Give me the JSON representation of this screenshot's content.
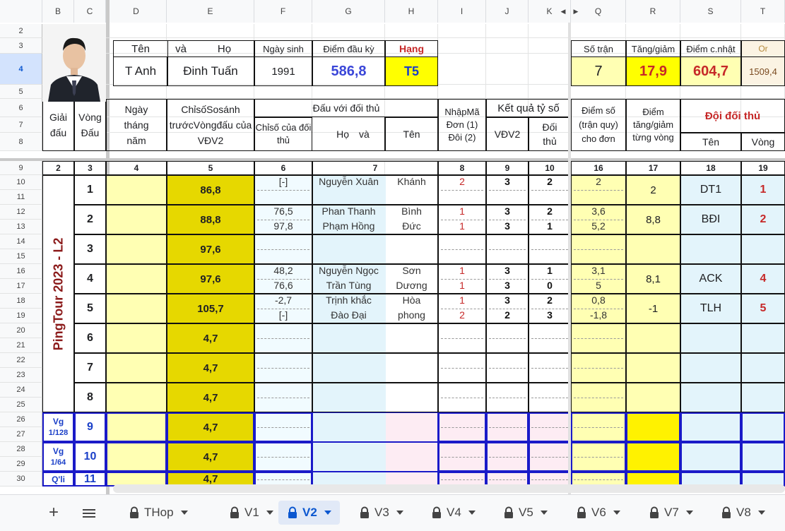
{
  "columns": [
    "B",
    "C",
    "D",
    "E",
    "F",
    "G",
    "H",
    "I",
    "J",
    "K",
    "Q",
    "R",
    "S",
    "T"
  ],
  "rows": [
    "2",
    "3",
    "4",
    "5",
    "6",
    "7",
    "8",
    "9",
    "10",
    "11",
    "12",
    "13",
    "14",
    "15",
    "16",
    "17",
    "18",
    "19",
    "20",
    "21",
    "22",
    "23",
    "24",
    "25",
    "26",
    "27",
    "28",
    "29",
    "30"
  ],
  "player": {
    "header": {
      "ten": "Tên",
      "va": "và",
      "ho": "Họ",
      "ngay_sinh": "Ngày sinh",
      "diem_dau_ky": "Điểm đầu kỳ",
      "hang": "Hạng"
    },
    "ten_value": "T Anh",
    "ho_value": "Đinh Tuấn",
    "ngay_sinh_value": "1991",
    "diem_dau_ky_value": "586,8",
    "hang_value": "T5"
  },
  "summary": {
    "header": {
      "so_tran": "Số trận",
      "tang_giam": "Tăng/giảm",
      "diem_cnhat": "Điểm c.nhật",
      "or": "Or"
    },
    "so_tran_value": "7",
    "tang_giam_value": "17,9",
    "diem_cnhat_value": "604,7",
    "or_value": "1509,4"
  },
  "table_header": {
    "giai_dau": "Giải đấu",
    "vong_dau": "Vòng Đấu",
    "ngay_thang_nam": "Ngày tháng năm",
    "chiso": "ChỉsốSosánh trướcVòngđấu của VĐV2",
    "dau_voi": "Đấu với đối thủ",
    "chiso_doithu": "Chỉsố của đối thủ",
    "ho": "Họ",
    "va": "và",
    "ten": "Tên",
    "nhap_ma": "NhậpMã Đơn (1) Đôi (2)",
    "ket_qua": "Kết quả tỷ số",
    "vdv2": "VĐV2",
    "doi_thu": "Đối thủ",
    "diem_so": "Điểm số (trận quy) cho đơn",
    "diem_tang_giam": "Điểm tăng/giảm từng vòng",
    "doi_doi_thu": "Đội đối thủ",
    "ten_doi": "Tên",
    "vong": "Vòng"
  },
  "colnums": [
    "2",
    "3",
    "4",
    "5",
    "6",
    "7",
    "8",
    "9",
    "10",
    "16",
    "17",
    "18",
    "19"
  ],
  "tournament": "PingTour 2023 - L2",
  "special_labels": [
    {
      "line1": "Vg",
      "line2": "1/128"
    },
    {
      "line1": "Vg",
      "line2": "1/64"
    },
    {
      "line1": "Q'li",
      "line2": ""
    }
  ],
  "rounds": [
    {
      "vong": "1",
      "chiso": "86,8",
      "matches": [
        {
          "chiso_dt": "[-]",
          "ho": "Nguyễn Xuân",
          "ten": "Khánh",
          "ma": "2",
          "vdv2": "3",
          "dt": "2",
          "diem": "2"
        }
      ],
      "tang": "2",
      "doi": "DT1",
      "vong_doi": "1"
    },
    {
      "vong": "2",
      "chiso": "88,8",
      "matches": [
        {
          "chiso_dt": "76,5",
          "ho": "Phan Thanh",
          "ten": "Bình",
          "ma": "1",
          "vdv2": "3",
          "dt": "2",
          "diem": "3,6"
        },
        {
          "chiso_dt": "97,8",
          "ho": "Phạm Hồng",
          "ten": "Đức",
          "ma": "1",
          "vdv2": "3",
          "dt": "1",
          "diem": "5,2"
        }
      ],
      "tang": "8,8",
      "doi": "BĐI",
      "vong_doi": "2"
    },
    {
      "vong": "3",
      "chiso": "97,6",
      "matches": [],
      "tang": "",
      "doi": "",
      "vong_doi": ""
    },
    {
      "vong": "4",
      "chiso": "97,6",
      "matches": [
        {
          "chiso_dt": "48,2",
          "ho": "Nguyễn Ngọc",
          "ten": "Sơn",
          "ma": "1",
          "vdv2": "3",
          "dt": "1",
          "diem": "3,1"
        },
        {
          "chiso_dt": "76,6",
          "ho": "Trần Tùng",
          "ten": "Dương",
          "ma": "1",
          "vdv2": "3",
          "dt": "0",
          "diem": "5"
        }
      ],
      "tang": "8,1",
      "doi": "ACK",
      "vong_doi": "4"
    },
    {
      "vong": "5",
      "chiso": "105,7",
      "matches": [
        {
          "chiso_dt": "-2,7",
          "ho": "Trịnh khắc",
          "ten": "Hòa",
          "ma": "1",
          "vdv2": "3",
          "dt": "2",
          "diem": "0,8"
        },
        {
          "chiso_dt": "[-]",
          "ho": "Đào Đại",
          "ten": "phong",
          "ma": "2",
          "vdv2": "2",
          "dt": "3",
          "diem": "-1,8"
        }
      ],
      "tang": "-1",
      "doi": "TLH",
      "vong_doi": "5"
    },
    {
      "vong": "6",
      "chiso": "4,7",
      "matches": [],
      "tang": "",
      "doi": "",
      "vong_doi": ""
    },
    {
      "vong": "7",
      "chiso": "4,7",
      "matches": [],
      "tang": "",
      "doi": "",
      "vong_doi": ""
    },
    {
      "vong": "8",
      "chiso": "4,7",
      "matches": [],
      "tang": "",
      "doi": "",
      "vong_doi": ""
    },
    {
      "vong": "9",
      "chiso": "4,7",
      "matches": [],
      "tang": "",
      "doi": "",
      "vong_doi": ""
    },
    {
      "vong": "10",
      "chiso": "4,7",
      "matches": [],
      "tang": "",
      "doi": "",
      "vong_doi": ""
    },
    {
      "vong": "11",
      "chiso": "4,7",
      "matches": [],
      "tang": "",
      "doi": "",
      "vong_doi": ""
    }
  ],
  "tabs": [
    "THop",
    "V1",
    "V2",
    "V3",
    "V4",
    "V5",
    "V6",
    "V7",
    "V8"
  ],
  "active_tab": "V2",
  "colors": {
    "yellow": "#ffff00",
    "light_yellow": "#ffffb3",
    "olive": "#e6d800",
    "light_blue": "#e3f4fb",
    "blue_text": "#3a46d8",
    "red_text": "#c62828",
    "dark_red": "#8b1a1a"
  }
}
